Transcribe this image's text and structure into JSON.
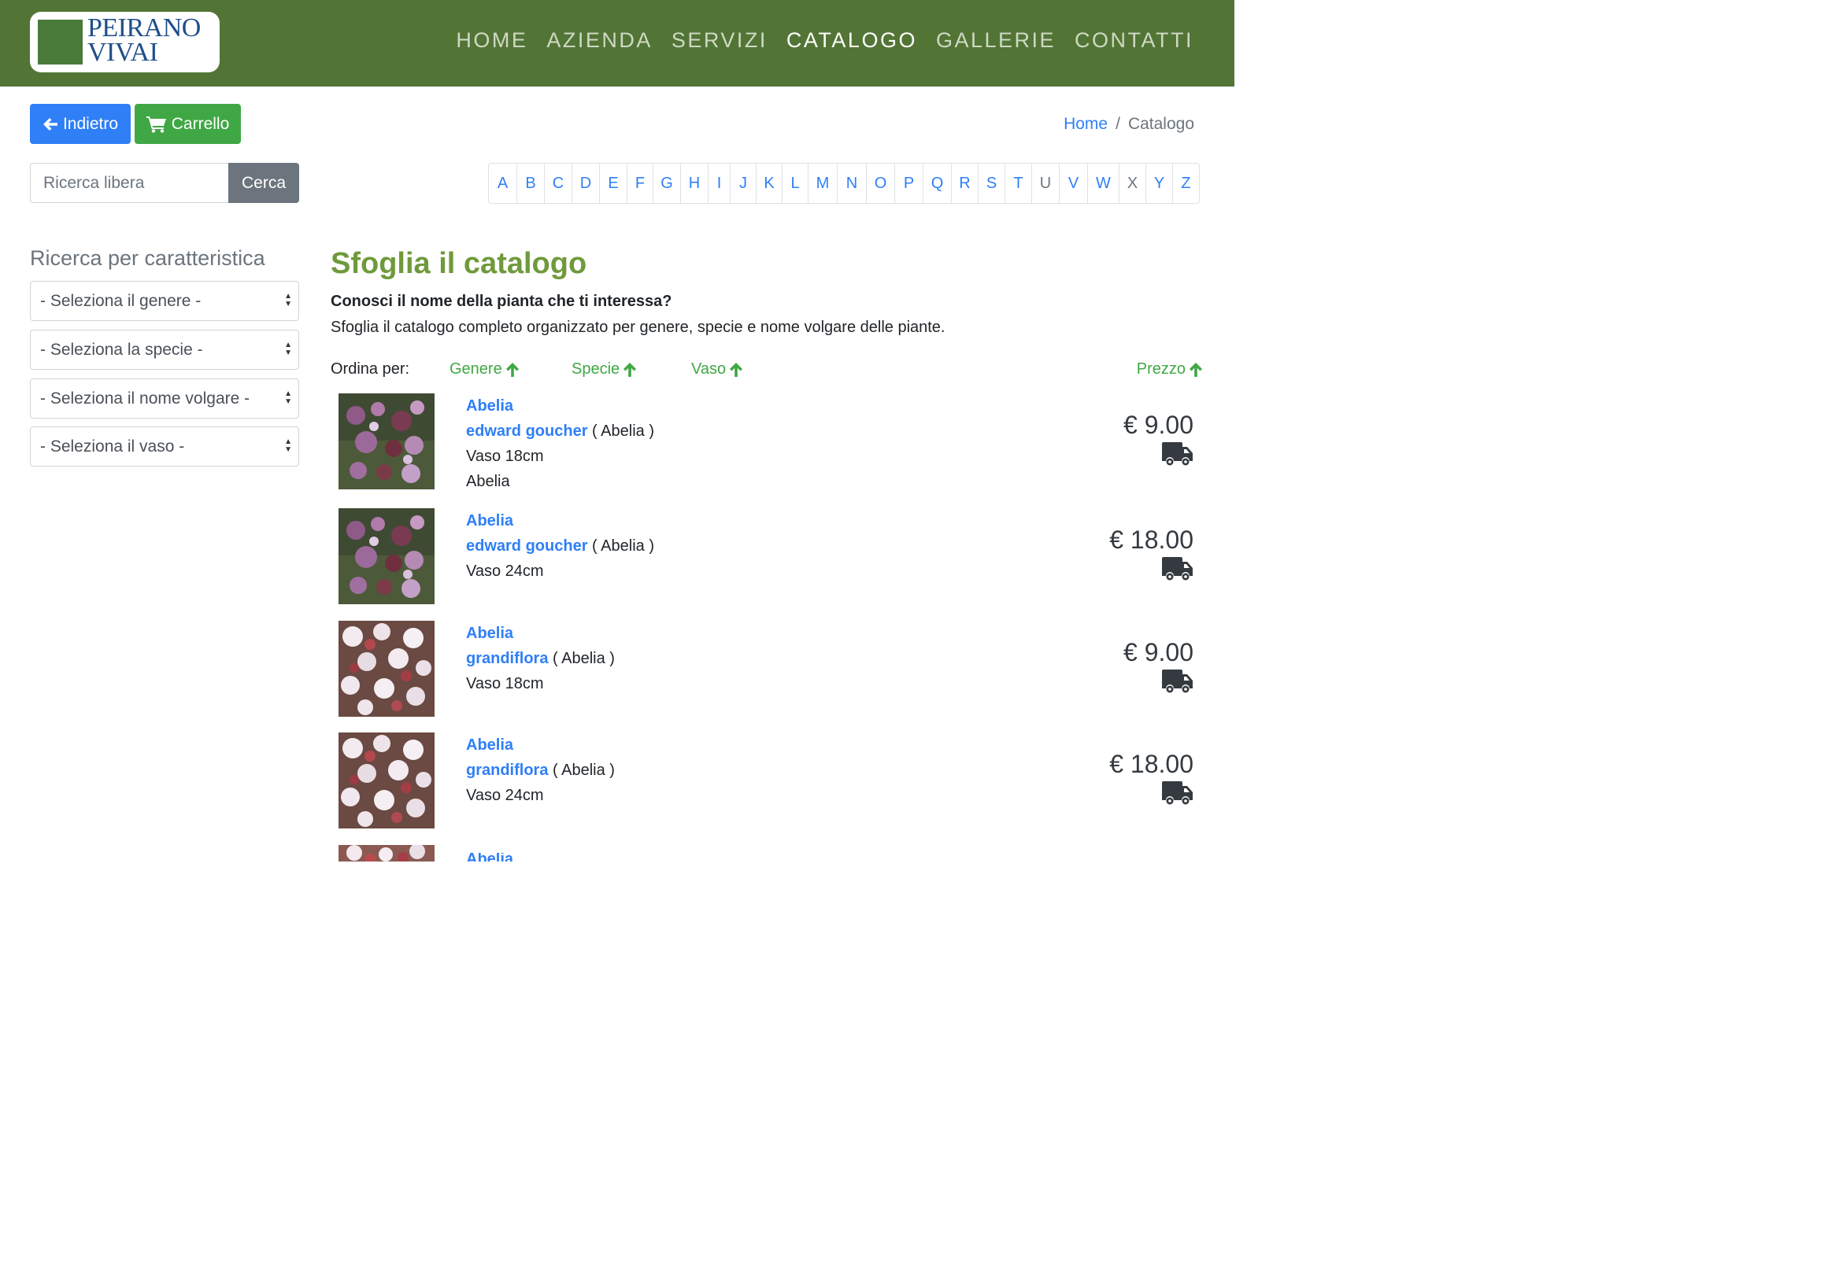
{
  "header": {
    "logo_line1": "PEIRANO",
    "logo_line2": "VIVAI",
    "nav": [
      {
        "label": "HOME",
        "active": false
      },
      {
        "label": "AZIENDA",
        "active": false
      },
      {
        "label": "SERVIZI",
        "active": false
      },
      {
        "label": "CATALOGO",
        "active": true
      },
      {
        "label": "GALLERIE",
        "active": false
      },
      {
        "label": "CONTATTI",
        "active": false
      }
    ],
    "bar_color": "#527535"
  },
  "toolbar": {
    "back_label": "Indietro",
    "cart_label": "Carrello"
  },
  "breadcrumb": {
    "home": "Home",
    "separator": "/",
    "current": "Catalogo"
  },
  "search": {
    "placeholder": "Ricerca libera",
    "button": "Cerca"
  },
  "alphabet": [
    {
      "letter": "A",
      "enabled": true
    },
    {
      "letter": "B",
      "enabled": true
    },
    {
      "letter": "C",
      "enabled": true
    },
    {
      "letter": "D",
      "enabled": true
    },
    {
      "letter": "E",
      "enabled": true
    },
    {
      "letter": "F",
      "enabled": true
    },
    {
      "letter": "G",
      "enabled": true
    },
    {
      "letter": "H",
      "enabled": true
    },
    {
      "letter": "I",
      "enabled": true
    },
    {
      "letter": "J",
      "enabled": true
    },
    {
      "letter": "K",
      "enabled": true
    },
    {
      "letter": "L",
      "enabled": true
    },
    {
      "letter": "M",
      "enabled": true
    },
    {
      "letter": "N",
      "enabled": true
    },
    {
      "letter": "O",
      "enabled": true
    },
    {
      "letter": "P",
      "enabled": true
    },
    {
      "letter": "Q",
      "enabled": true
    },
    {
      "letter": "R",
      "enabled": true
    },
    {
      "letter": "S",
      "enabled": true
    },
    {
      "letter": "T",
      "enabled": true
    },
    {
      "letter": "U",
      "enabled": false
    },
    {
      "letter": "V",
      "enabled": true
    },
    {
      "letter": "W",
      "enabled": true
    },
    {
      "letter": "X",
      "enabled": false
    },
    {
      "letter": "Y",
      "enabled": true
    },
    {
      "letter": "Z",
      "enabled": true
    }
  ],
  "sidebar": {
    "title": "Ricerca per caratteristica",
    "selects": [
      "- Seleziona il genere -",
      "- Seleziona la specie -",
      "- Seleziona il nome volgare -",
      "- Seleziona il vaso -"
    ]
  },
  "main": {
    "title": "Sfoglia il catalogo",
    "subtitle": "Conosci il nome della pianta che ti interessa?",
    "description": "Sfoglia il catalogo completo organizzato per genere, specie e nome volgare delle piante.",
    "sort_label": "Ordina per:",
    "sort": {
      "genere": "Genere",
      "specie": "Specie",
      "vaso": "Vaso",
      "prezzo": "Prezzo"
    }
  },
  "products": [
    {
      "genus": "Abelia",
      "species": "edward goucher",
      "genus_paren": "( Abelia )",
      "pot": "Vaso 18cm",
      "common": "Abelia",
      "price": "€ 9.00",
      "image": "dark"
    },
    {
      "genus": "Abelia",
      "species": "edward goucher",
      "genus_paren": "( Abelia )",
      "pot": "Vaso 24cm",
      "common": "",
      "price": "€ 18.00",
      "image": "dark"
    },
    {
      "genus": "Abelia",
      "species": "grandiflora",
      "genus_paren": "( Abelia )",
      "pot": "Vaso 18cm",
      "common": "",
      "price": "€ 9.00",
      "image": "light"
    },
    {
      "genus": "Abelia",
      "species": "grandiflora",
      "genus_paren": "( Abelia )",
      "pot": "Vaso 24cm",
      "common": "",
      "price": "€ 18.00",
      "image": "light"
    }
  ],
  "colors": {
    "accent_green": "#6f9a3b",
    "link_blue": "#2f7ff6",
    "button_green": "#40a745",
    "button_gray": "#6c757d"
  }
}
